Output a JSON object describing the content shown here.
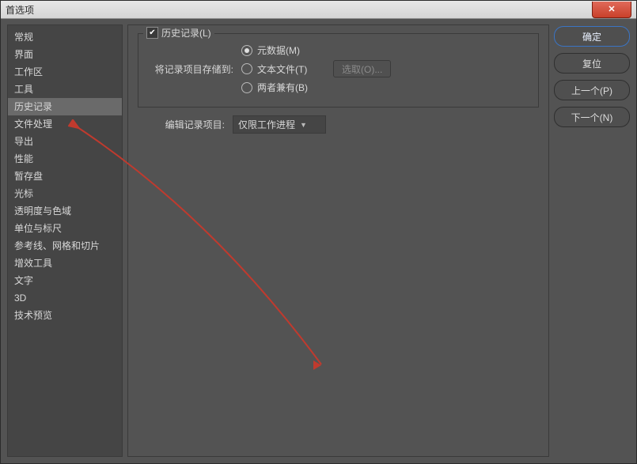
{
  "window": {
    "title": "首选项"
  },
  "sidebar": {
    "items": [
      {
        "label": "常规"
      },
      {
        "label": "界面"
      },
      {
        "label": "工作区"
      },
      {
        "label": "工具"
      },
      {
        "label": "历史记录",
        "selected": true
      },
      {
        "label": "文件处理"
      },
      {
        "label": "导出"
      },
      {
        "label": "性能"
      },
      {
        "label": "暂存盘"
      },
      {
        "label": "光标"
      },
      {
        "label": "透明度与色域"
      },
      {
        "label": "单位与标尺"
      },
      {
        "label": "参考线、网格和切片"
      },
      {
        "label": "增效工具"
      },
      {
        "label": "文字"
      },
      {
        "label": "3D"
      },
      {
        "label": "技术预览"
      }
    ]
  },
  "main": {
    "history_checkbox_label": "历史记录(L)",
    "save_label": "将记录项目存储到:",
    "radios": {
      "metadata": "元数据(M)",
      "textfile": "文本文件(T)",
      "both": "两者兼有(B)"
    },
    "choose_btn": "选取(O)...",
    "edit_label": "编辑记录项目:",
    "edit_select_value": "仅限工作进程"
  },
  "buttons": {
    "ok": "确定",
    "reset": "复位",
    "prev": "上一个(P)",
    "next": "下一个(N)"
  }
}
